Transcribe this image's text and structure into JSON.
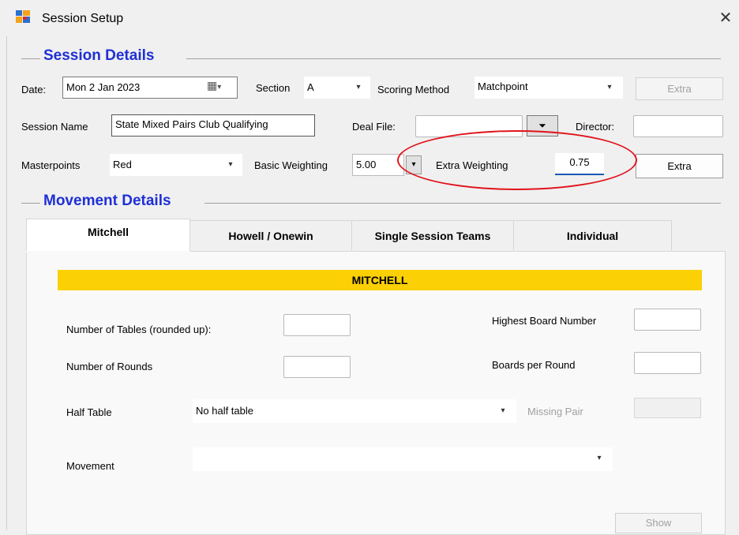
{
  "window": {
    "title": "Session Setup",
    "close_glyph": "✕"
  },
  "session_details": {
    "heading": "Session Details",
    "date_label": "Date:",
    "date_value": "Mon  2 Jan 2023",
    "section_label": "Section",
    "section_value": "A",
    "scoring_label": "Scoring Method",
    "scoring_value": "Matchpoint",
    "extra_button_1": "Extra",
    "session_name_label": "Session Name",
    "session_name_value": "State Mixed Pairs Club Qualifying",
    "deal_file_label": "Deal File:",
    "deal_file_value": "",
    "director_label": "Director:",
    "director_value": "",
    "masterpoints_label": "Masterpoints",
    "masterpoints_value": "Red",
    "basic_weighting_label": "Basic Weighting",
    "basic_weighting_value": "5.00",
    "extra_weighting_label": "Extra Weighting",
    "extra_weighting_value": "0.75",
    "extra_button_2": "Extra"
  },
  "movement_details": {
    "heading": "Movement Details",
    "tabs": [
      {
        "label": "Mitchell",
        "active": true
      },
      {
        "label": "Howell / Onewin",
        "active": false
      },
      {
        "label": "Single Session Teams",
        "active": false
      },
      {
        "label": "Individual",
        "active": false
      }
    ],
    "banner": "MITCHELL",
    "num_tables_label": "Number of Tables (rounded up):",
    "num_tables_value": "",
    "num_rounds_label": "Number of Rounds",
    "num_rounds_value": "",
    "highest_board_label": "Highest Board Number",
    "highest_board_value": "",
    "boards_per_round_label": "Boards per Round",
    "boards_per_round_value": "",
    "half_table_label": "Half Table",
    "half_table_value": "No half table",
    "missing_pair_label": "Missing Pair",
    "movement_label": "Movement",
    "movement_value": "",
    "show_button": "Show"
  },
  "icons": {
    "dropdown_glyph": "▾",
    "calendar_glyph": "▦",
    "browse_glyph": "⏷"
  },
  "colors": {
    "heading_blue": "#1f2fd6",
    "banner_yellow": "#fbd004",
    "annotation_red": "#e0141c"
  }
}
